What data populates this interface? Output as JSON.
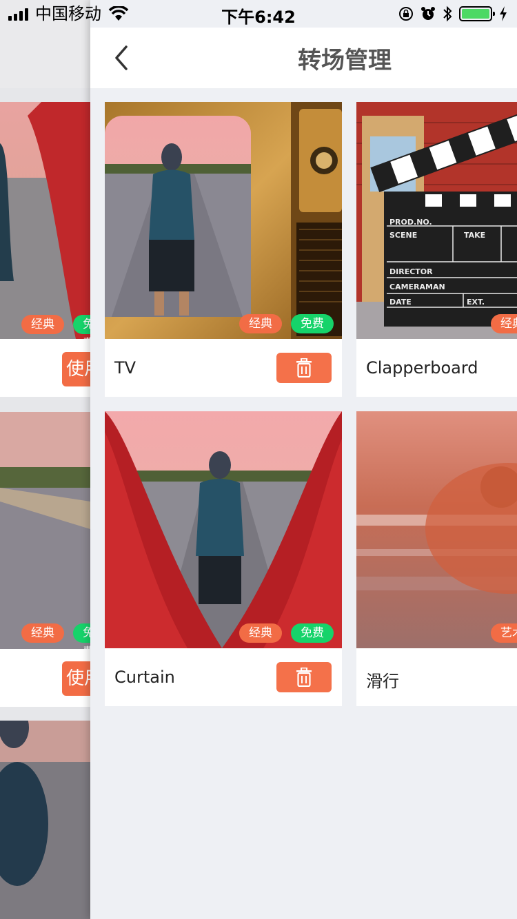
{
  "status_bar": {
    "carrier": "中国移动",
    "time": "下午6:42"
  },
  "nav": {
    "title": "转场管理"
  },
  "transitions": [
    {
      "name": "TV",
      "badges": [
        "经典",
        "免费"
      ]
    },
    {
      "name": "Clapperboard",
      "badges": [
        "经典"
      ]
    },
    {
      "name": "Curtain",
      "badges": [
        "经典",
        "免费"
      ]
    },
    {
      "name": "滑行",
      "badges": [
        "艺术"
      ]
    }
  ],
  "background_page": {
    "badges": [
      "经典",
      "免费"
    ],
    "use_label": "使用"
  },
  "clapperboard_text": {
    "prod": "PROD.NO.",
    "scene": "SCENE",
    "take": "TAKE",
    "director": "DIRECTOR",
    "cameraman": "CAMERAMAN",
    "date": "DATE",
    "ext": "EXT."
  },
  "colors": {
    "accent": "#f4714a",
    "badge_classic": "#f26c45",
    "badge_free": "#16d36a",
    "battery": "#4cd964"
  },
  "icons": {
    "back": "chevron-left-icon",
    "delete": "trash-icon"
  }
}
